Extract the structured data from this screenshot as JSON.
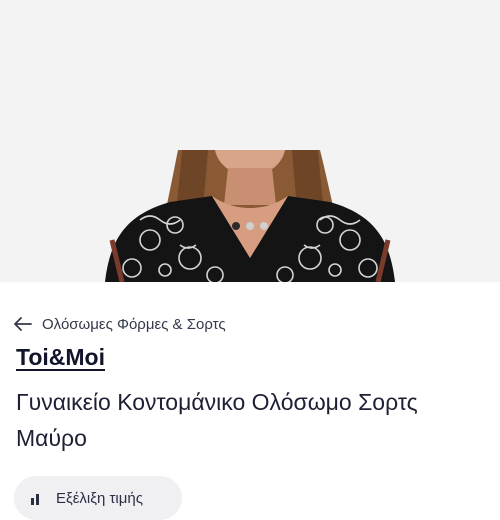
{
  "gallery": {
    "image_alt": "product-photo",
    "dots_count": 3,
    "active_dot": 0
  },
  "breadcrumb": {
    "label": "Ολόσωμες Φόρμες & Σορτς"
  },
  "product": {
    "brand": "Toi&Moi",
    "title": "Γυναικείο Κοντομάνικο Ολόσωμο Σορτς Μαύρο"
  },
  "actions": {
    "price_history_label": "Εξέλιξη τιμής"
  },
  "colors": {
    "background": "#ffffff",
    "hero_background": "#f3f3f3",
    "text": "#1a1a2e",
    "chip": "#f0f0f2"
  }
}
